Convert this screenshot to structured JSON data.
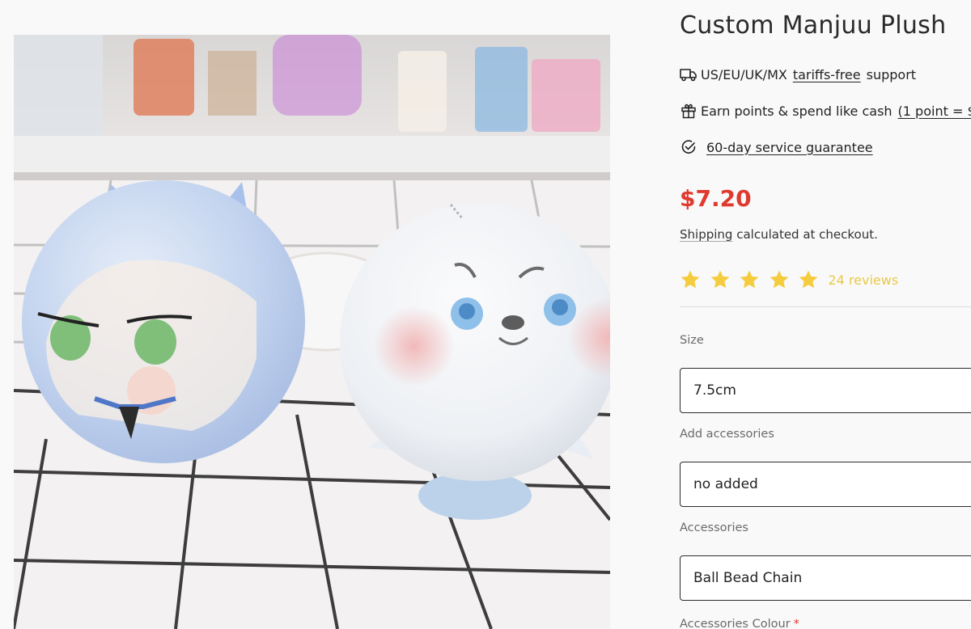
{
  "product": {
    "title": "Custom Manjuu Plush",
    "image_alt": "Two round manjuu plush keychains on a checkered cloth"
  },
  "features": [
    {
      "icon": "truck-icon",
      "prefix": "US/EU/UK/MX",
      "link": "tariffs-free",
      "suffix": "support"
    },
    {
      "icon": "gift-icon",
      "prefix": "Earn points & spend like cash",
      "link": "(1 point = $"
    },
    {
      "icon": "check-circle-icon",
      "link": "60-day service guarantee"
    }
  ],
  "price": {
    "value": "$7.20",
    "color": "#e03a2f"
  },
  "shipping": {
    "link": "Shipping",
    "text": "calculated at checkout."
  },
  "rating": {
    "stars": 5,
    "max": 5,
    "reviews_label": "24 reviews",
    "star_color": "#f5cc3e"
  },
  "options": [
    {
      "label": "Size",
      "value": "7.5cm"
    },
    {
      "label": "Add accessories",
      "value": "no added"
    },
    {
      "label": "Accessories",
      "value": "Ball Bead Chain"
    },
    {
      "label": "Accessories Colour",
      "required_mark": "*"
    }
  ]
}
